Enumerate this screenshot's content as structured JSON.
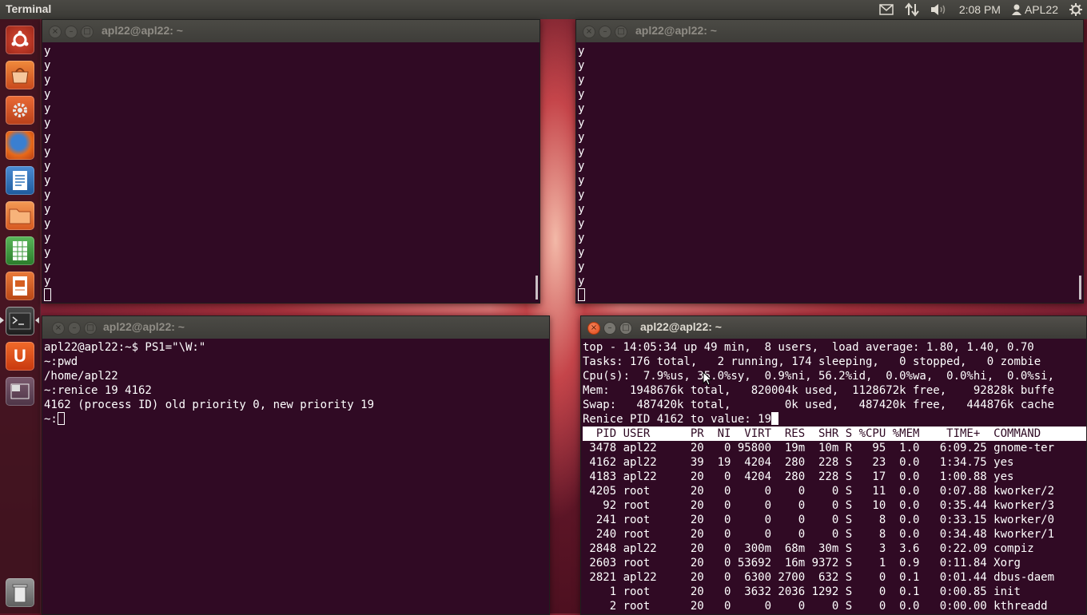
{
  "top_panel": {
    "app_title": "Terminal",
    "clock": "2:08 PM",
    "user": "APL22",
    "icons": [
      "mail-icon",
      "network-arrows-icon",
      "volume-icon",
      "user-icon",
      "gear-icon"
    ]
  },
  "launcher": {
    "items": [
      {
        "name": "dash-home-icon",
        "color": "#c8352a"
      },
      {
        "name": "software-center-icon",
        "color": "#e06a2b"
      },
      {
        "name": "system-settings-icon",
        "color": "#d9531e"
      },
      {
        "name": "firefox-icon",
        "color": "#e66a1f"
      },
      {
        "name": "libreoffice-writer-icon",
        "color": "#2d72b8"
      },
      {
        "name": "files-icon",
        "color": "#e0722e"
      },
      {
        "name": "libreoffice-calc-icon",
        "color": "#3b9a3b"
      },
      {
        "name": "libreoffice-impress-icon",
        "color": "#d55f22"
      },
      {
        "name": "terminal-icon",
        "color": "#2c2c2c"
      },
      {
        "name": "ubuntu-one-icon",
        "color": "#dd4814"
      },
      {
        "name": "workspace-switcher-icon",
        "color": "#6b4b5f"
      },
      {
        "name": "trash-icon",
        "color": "#8a8a8a"
      }
    ]
  },
  "windows": {
    "tl": {
      "title": "apl22@apl22: ~",
      "lines": [
        "y",
        "y",
        "y",
        "y",
        "y",
        "y",
        "y",
        "y",
        "y",
        "y",
        "y",
        "y",
        "y",
        "y",
        "y",
        "y",
        "y"
      ]
    },
    "tr": {
      "title": "apl22@apl22: ~",
      "lines": [
        "y",
        "y",
        "y",
        "y",
        "y",
        "y",
        "y",
        "y",
        "y",
        "y",
        "y",
        "y",
        "y",
        "y",
        "y",
        "y",
        "y"
      ]
    },
    "bl": {
      "title": "apl22@apl22: ~",
      "lines": [
        "apl22@apl22:~$ PS1=\"\\W:\"",
        "~:pwd",
        "/home/apl22",
        "~:renice 19 4162",
        "4162 (process ID) old priority 0, new priority 19"
      ],
      "prompt": "~:"
    },
    "br": {
      "title": "apl22@apl22: ~",
      "summary": [
        "top - 14:05:34 up 49 min,  8 users,  load average: 1.80, 1.40, 0.70",
        "Tasks: 176 total,   2 running, 174 sleeping,   0 stopped,   0 zombie",
        "Cpu(s):  7.9%us, 35.0%sy,  0.9%ni, 56.2%id,  0.0%wa,  0.0%hi,  0.0%si,",
        "Mem:   1948676k total,   820004k used,  1128672k free,    92828k buffe",
        "Swap:   487420k total,        0k used,   487420k free,   444876k cache"
      ],
      "renice_prompt": "Renice PID 4162 to value: 19",
      "header": "  PID USER      PR  NI  VIRT  RES  SHR S %CPU %MEM    TIME+  COMMAND     ",
      "rows": [
        " 3478 apl22     20   0 95800  19m  10m R   95  1.0   6:09.25 gnome-ter",
        " 4162 apl22     39  19  4204  280  228 S   23  0.0   1:34.75 yes",
        " 4183 apl22     20   0  4204  280  228 S   17  0.0   1:00.88 yes",
        " 4205 root      20   0     0    0    0 S   11  0.0   0:07.88 kworker/2",
        "   92 root      20   0     0    0    0 S   10  0.0   0:35.44 kworker/3",
        "  241 root      20   0     0    0    0 S    8  0.0   0:33.15 kworker/0",
        "  240 root      20   0     0    0    0 S    8  0.0   0:34.48 kworker/1",
        " 2848 apl22     20   0  300m  68m  30m S    3  3.6   0:22.09 compiz",
        " 2603 root      20   0 53692  16m 9372 S    1  0.9   0:11.84 Xorg",
        " 2821 apl22     20   0  6300 2700  632 S    0  0.1   0:01.44 dbus-daem",
        "    1 root      20   0  3632 2036 1292 S    0  0.1   0:00.85 init",
        "    2 root      20   0     0    0    0 S    0  0.0   0:00.00 kthreadd"
      ]
    }
  }
}
